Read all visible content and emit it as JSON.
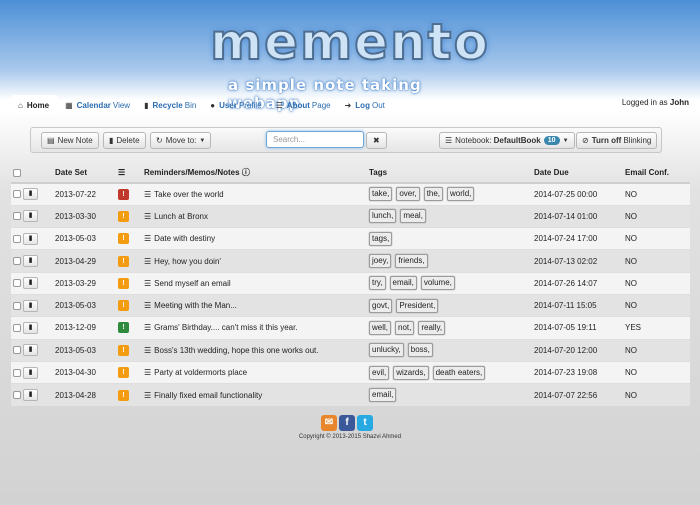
{
  "header": {
    "logo": "memento",
    "tagline": "a simple note taking webapp"
  },
  "nav": {
    "items": [
      {
        "bold": "Home",
        "rest": "",
        "icon": "home-icon",
        "active": true
      },
      {
        "bold": "Calendar",
        "rest": "View",
        "icon": "calendar-icon"
      },
      {
        "bold": "Recycle",
        "rest": "Bin",
        "icon": "trash-icon"
      },
      {
        "bold": "User",
        "rest": "Profile",
        "icon": "user-icon"
      },
      {
        "bold": "About",
        "rest": "Page",
        "icon": "list-icon"
      },
      {
        "bold": "Log",
        "rest": "Out",
        "icon": "logout-icon"
      }
    ],
    "logged_in_prefix": "Logged in as",
    "user": "John"
  },
  "toolbar": {
    "new_note": "New Note",
    "delete": "Delete",
    "move_to": "Move to:",
    "search_placeholder": "Search...",
    "search_clear": "✖",
    "notebook_prefix": "Notebook:",
    "notebook_name": "DefaultBook",
    "notebook_count": "10",
    "blink_bold": "Turn off",
    "blink_rest": "Blinking"
  },
  "table": {
    "headers": {
      "date_set": "Date Set",
      "notes": "Reminders/Memos/Notes",
      "tags": "Tags",
      "date_due": "Date Due",
      "email": "Email Conf."
    },
    "rows": [
      {
        "date_set": "2013-07-22",
        "status": "red",
        "note": "Take over the world",
        "tags": [
          "take,",
          "over,",
          "the,",
          "world,"
        ],
        "due": "2014-07-25 00:00",
        "email": "NO"
      },
      {
        "date_set": "2013-03-30",
        "status": "orange",
        "note": "Lunch at Bronx",
        "tags": [
          "lunch,",
          "meal,"
        ],
        "due": "2014-07-14 01:00",
        "email": "NO"
      },
      {
        "date_set": "2013-05-03",
        "status": "orange",
        "note": "Date with destiny",
        "tags": [
          "tags,"
        ],
        "due": "2014-07-24 17:00",
        "email": "NO"
      },
      {
        "date_set": "2013-04-29",
        "status": "orange",
        "note": "Hey, how you doin'",
        "tags": [
          "joey,",
          "friends,"
        ],
        "due": "2014-07-13 02:02",
        "email": "NO"
      },
      {
        "date_set": "2013-03-29",
        "status": "orange",
        "note": "Send myself an email",
        "tags": [
          "try,",
          "email,",
          "volume,"
        ],
        "due": "2014-07-26 14:07",
        "email": "NO"
      },
      {
        "date_set": "2013-05-03",
        "status": "orange",
        "note": "Meeting with the Man...",
        "tags": [
          "govt,",
          "President,"
        ],
        "due": "2014-07-11 15:05",
        "email": "NO"
      },
      {
        "date_set": "2013-12-09",
        "status": "green",
        "note": "Grams' Birthday.... can't miss it this year.",
        "tags": [
          "well,",
          "not,",
          "really,"
        ],
        "due": "2014-07-05 19:11",
        "email": "YES"
      },
      {
        "date_set": "2013-05-03",
        "status": "orange",
        "note": "Boss's 13th wedding, hope this one works out.",
        "tags": [
          "unlucky,",
          "boss,"
        ],
        "due": "2014-07-20 12:00",
        "email": "NO"
      },
      {
        "date_set": "2013-04-30",
        "status": "orange",
        "note": "Party at voldermorts place",
        "tags": [
          "evil,",
          "wizards,",
          "death eaters,"
        ],
        "due": "2014-07-23 19:08",
        "email": "NO"
      },
      {
        "date_set": "2013-04-28",
        "status": "orange",
        "note": "Finally fixed email functionality",
        "tags": [
          "email,"
        ],
        "due": "2014-07-07 22:56",
        "email": "NO"
      }
    ]
  },
  "colors": {
    "red": "#c0392b",
    "orange": "#f39c12",
    "green": "#2e8b3d"
  },
  "footer": {
    "copyright": "Copyright © 2013-2015 Shazvi Ahmed"
  }
}
